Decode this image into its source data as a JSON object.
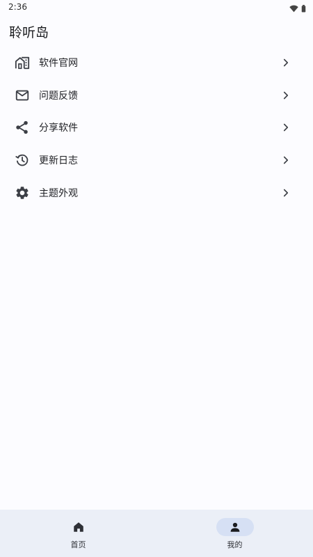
{
  "status_bar": {
    "time": "2:36",
    "icons": [
      "wifi-icon",
      "battery-icon"
    ]
  },
  "app": {
    "title": "聆听岛"
  },
  "menu": {
    "items": [
      {
        "label": "软件官网",
        "icon": "website-icon"
      },
      {
        "label": "问题反馈",
        "icon": "mail-icon"
      },
      {
        "label": "分享软件",
        "icon": "share-icon"
      },
      {
        "label": "更新日志",
        "icon": "history-icon"
      },
      {
        "label": "主题外观",
        "icon": "settings-icon"
      }
    ]
  },
  "bottom_nav": {
    "items": [
      {
        "label": "首页",
        "icon": "home-icon",
        "active": false
      },
      {
        "label": "我的",
        "icon": "person-icon",
        "active": true
      }
    ]
  },
  "colors": {
    "background": "#fcfcff",
    "nav_background": "#ebeff7",
    "active_pill": "#d6e0f4",
    "icon": "#3c3f46"
  }
}
